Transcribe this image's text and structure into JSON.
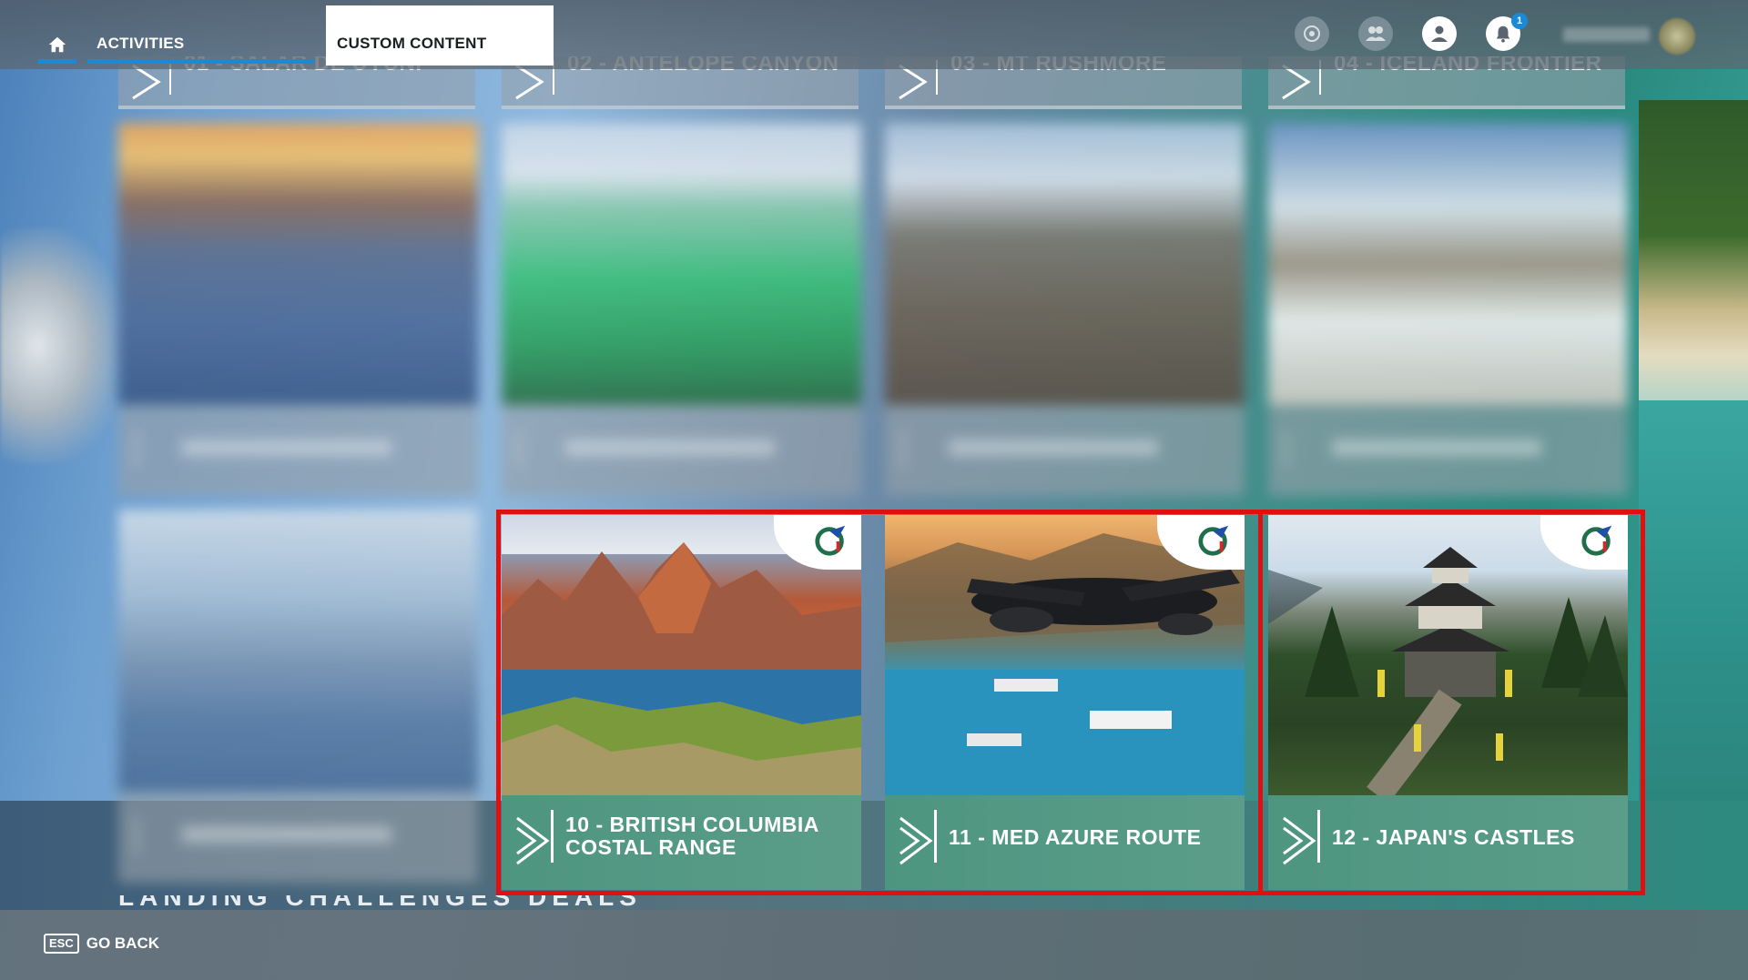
{
  "topbar": {
    "tabs": [
      {
        "label": "ACTIVITIES",
        "active": true
      },
      {
        "label": "CUSTOM CONTENT",
        "active": false
      }
    ],
    "notifications_count": "1",
    "icons": [
      "home-icon",
      "achievement-icon",
      "friends-icon",
      "profile-icon",
      "bell-icon"
    ]
  },
  "top_row": [
    {
      "label": "01 - SALAR DE UYUNI"
    },
    {
      "label": "02 - ANTELOPE CANYON"
    },
    {
      "label": "03 - MT RUSHMORE"
    },
    {
      "label": "04 - ICELAND FRONTIER"
    }
  ],
  "cards": [
    {
      "title": "10 - BRITISH COLUMBIA COSTAL RANGE",
      "line1": "10 - BRITISH COLUMBIA",
      "line2": "COSTAL RANGE"
    },
    {
      "title": "11 - MED AZURE ROUTE"
    },
    {
      "title": "12 - JAPAN'S CASTLES"
    }
  ],
  "section_heading": "LANDING CHALLENGES DEALS",
  "bottombar": {
    "esc_key": "ESC",
    "back_label": "GO BACK"
  },
  "colors": {
    "accent": "#1a8ad8",
    "selection": "#e01010",
    "card_footer": "#4e9680"
  }
}
